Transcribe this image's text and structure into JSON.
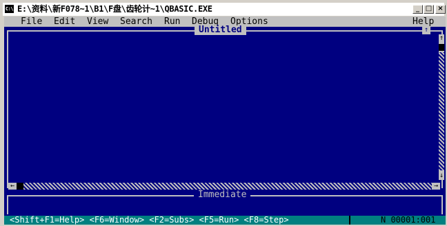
{
  "window": {
    "title": "E:\\资料\\新F078~1\\B1\\F盘\\齿轮计~1\\QBASIC.EXE",
    "sys_icon_text": "C:\\",
    "buttons": {
      "minimize": "_",
      "maximize": "□",
      "close": "×"
    }
  },
  "menubar": {
    "items": [
      "File",
      "Edit",
      "View",
      "Search",
      "Run",
      "Debug",
      "Options"
    ],
    "help": "Help"
  },
  "editor": {
    "document_title": "Untitled",
    "maximize_glyph": "↑",
    "scroll_up": "↑",
    "scroll_down": "↓",
    "scroll_left": "←",
    "scroll_right": "→"
  },
  "immediate": {
    "title": "Immediate"
  },
  "statusbar": {
    "hints": "<Shift+F1=Help> <F6=Window> <F2=Subs> <F5=Run> <F8=Step>",
    "position": "N 00001:001"
  },
  "colors": {
    "background": "#000080",
    "menubar": "#c0c0c0",
    "statusbar": "#008080"
  }
}
